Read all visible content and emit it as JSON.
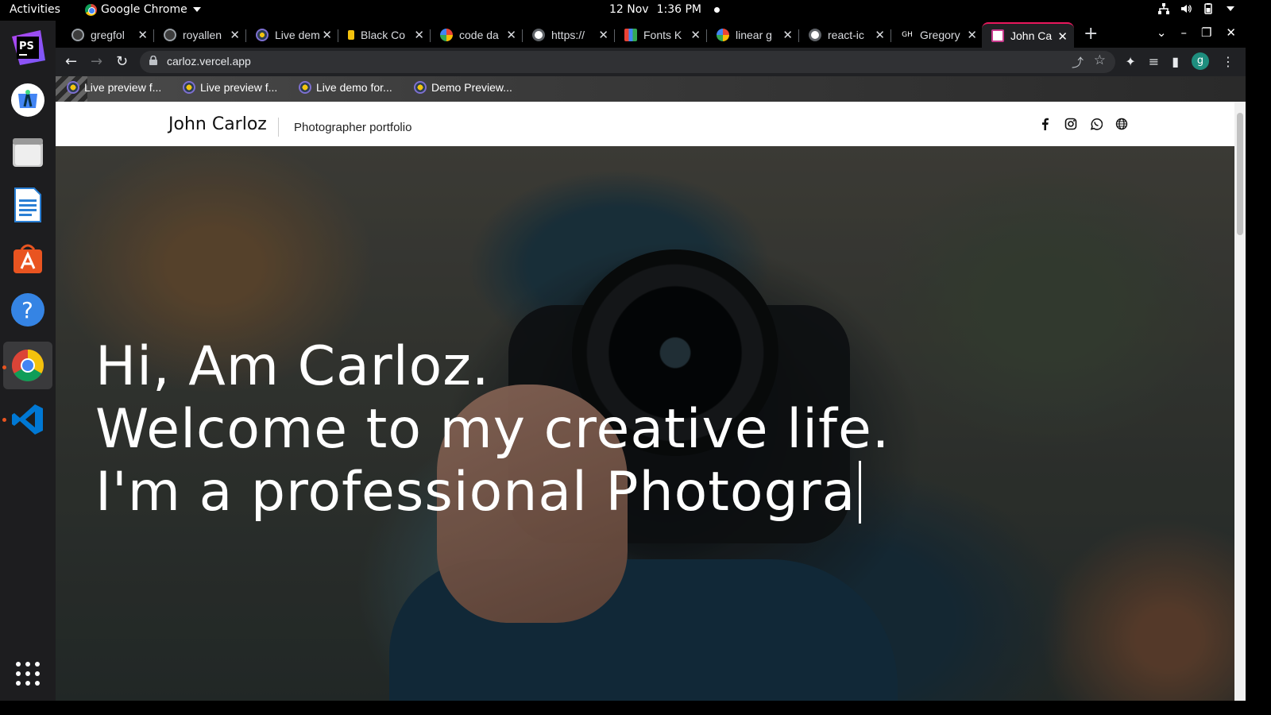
{
  "topbar": {
    "activities": "Activities",
    "app_name": "Google Chrome",
    "date": "12 Nov",
    "time": "1:36 PM"
  },
  "dock": {
    "apps": [
      "PhpStorm",
      "Android Studio",
      "Files",
      "LibreOffice Writer",
      "Ubuntu Software",
      "Help",
      "Google Chrome",
      "Visual Studio Code"
    ],
    "ps_label": "PS"
  },
  "tabs": [
    {
      "title": "gregfol",
      "icon": "github-icon"
    },
    {
      "title": "royallen",
      "icon": "github-icon"
    },
    {
      "title": "Live dem",
      "icon": "netlify-icon"
    },
    {
      "title": "Black Co",
      "icon": "bookmark-icon"
    },
    {
      "title": "code da",
      "icon": "google-icon"
    },
    {
      "title": "https://",
      "icon": "globe-icon"
    },
    {
      "title": "Fonts K",
      "icon": "fonts-icon"
    },
    {
      "title": "linear g",
      "icon": "google-icon"
    },
    {
      "title": "react-ic",
      "icon": "globe-icon"
    },
    {
      "title": "Gregory",
      "icon": "gh-icon"
    },
    {
      "title": "John Ca",
      "icon": "page-icon",
      "active": true
    }
  ],
  "toolbar": {
    "url": "carloz.vercel.app",
    "profile_initial": "g"
  },
  "bookmarks": [
    "Live preview f...",
    "Live preview f...",
    "Live demo for...",
    "Demo Preview..."
  ],
  "site": {
    "brand": "John Carloz",
    "tagline": "Photographer portfolio",
    "social_icons": [
      "facebook-icon",
      "instagram-icon",
      "whatsapp-icon",
      "globe-icon"
    ]
  },
  "hero": {
    "line1": "Hi, Am Carloz.",
    "line2": "Welcome to my creative life.",
    "line3": "I'm a professional Photogra"
  },
  "colors": {
    "active_tab_accent": "#e8175d",
    "chrome_dark": "#202124",
    "profile_bg": "#1e8e7e"
  }
}
